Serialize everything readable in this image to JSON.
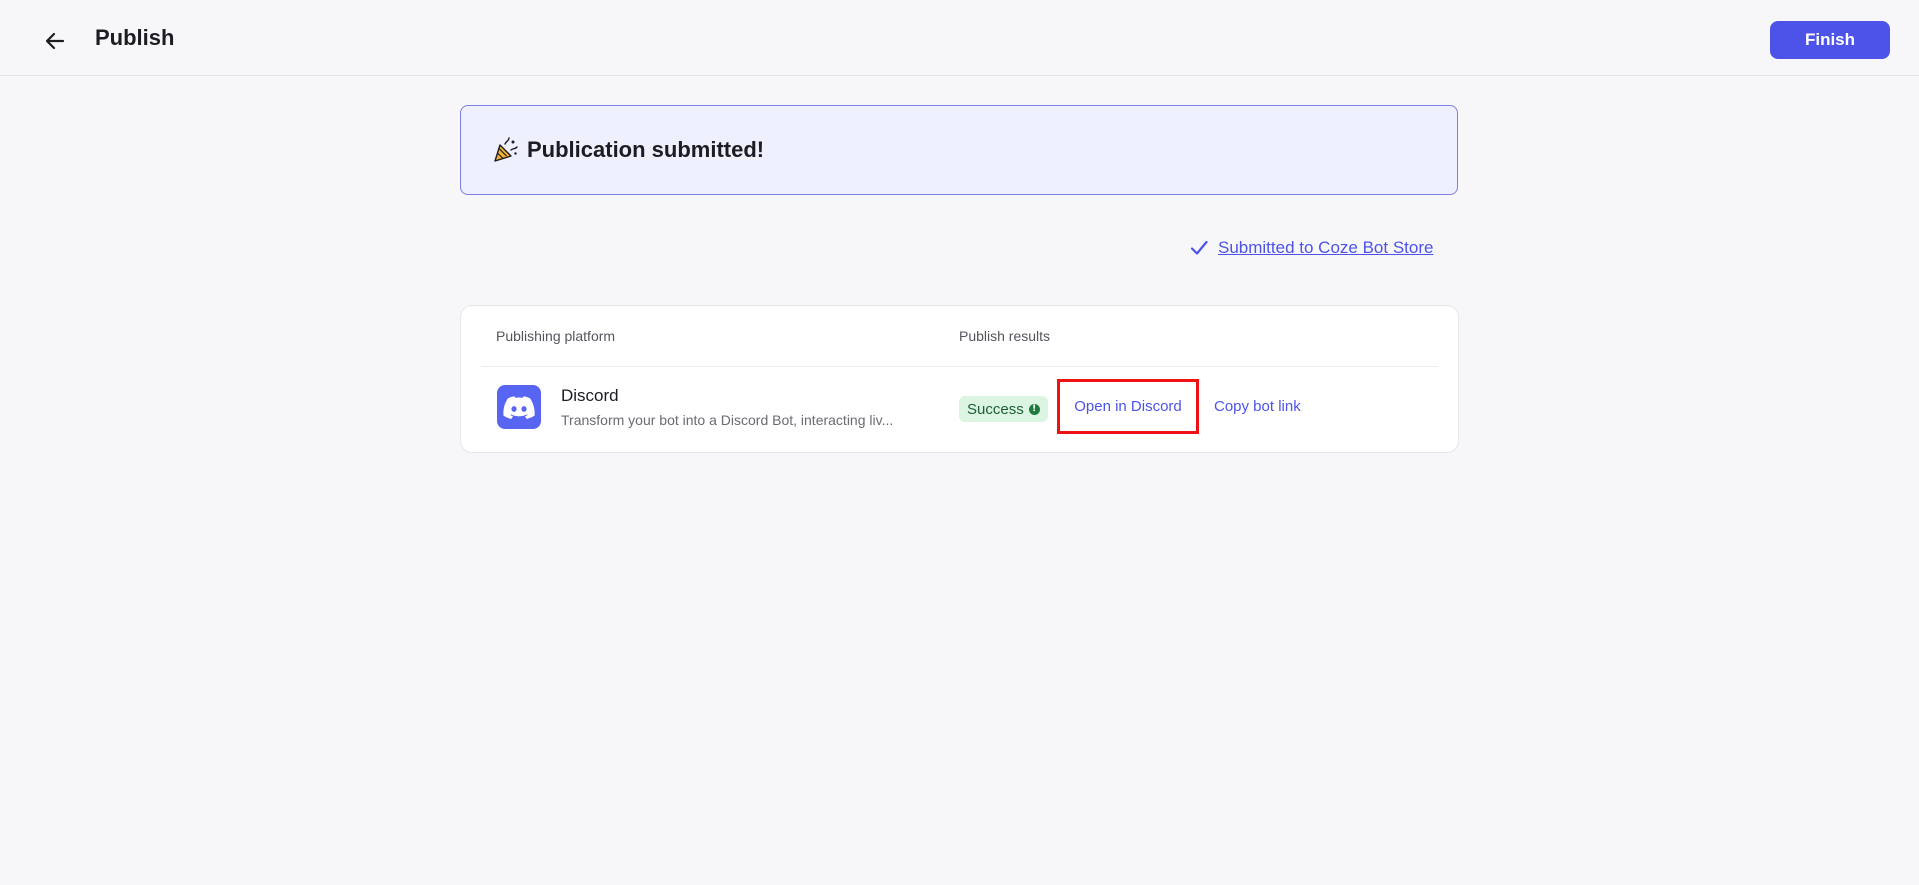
{
  "header": {
    "back_icon": "arrow-left-icon",
    "title": "Publish",
    "finish_label": "Finish"
  },
  "banner": {
    "icon": "party-popper-icon",
    "message": "Publication submitted!"
  },
  "store": {
    "icon": "checkmark-icon",
    "link_text": "Submitted to Coze Bot Store"
  },
  "table": {
    "headers": [
      "Publishing platform",
      "Publish results"
    ],
    "rows": [
      {
        "platform_name": "Discord",
        "platform_icon": "discord-logo-icon",
        "description": "Transform your bot into a Discord Bot, interacting liv...",
        "status": "Success",
        "status_icon": "info-icon",
        "actions": [
          "Open in Discord",
          "Copy bot link"
        ]
      }
    ]
  },
  "colors": {
    "accent": "#4d53e8",
    "success_bg": "#dcf5e3",
    "success_text": "#1b5e36",
    "discord": "#5865f2",
    "highlight": "#ee1212"
  }
}
